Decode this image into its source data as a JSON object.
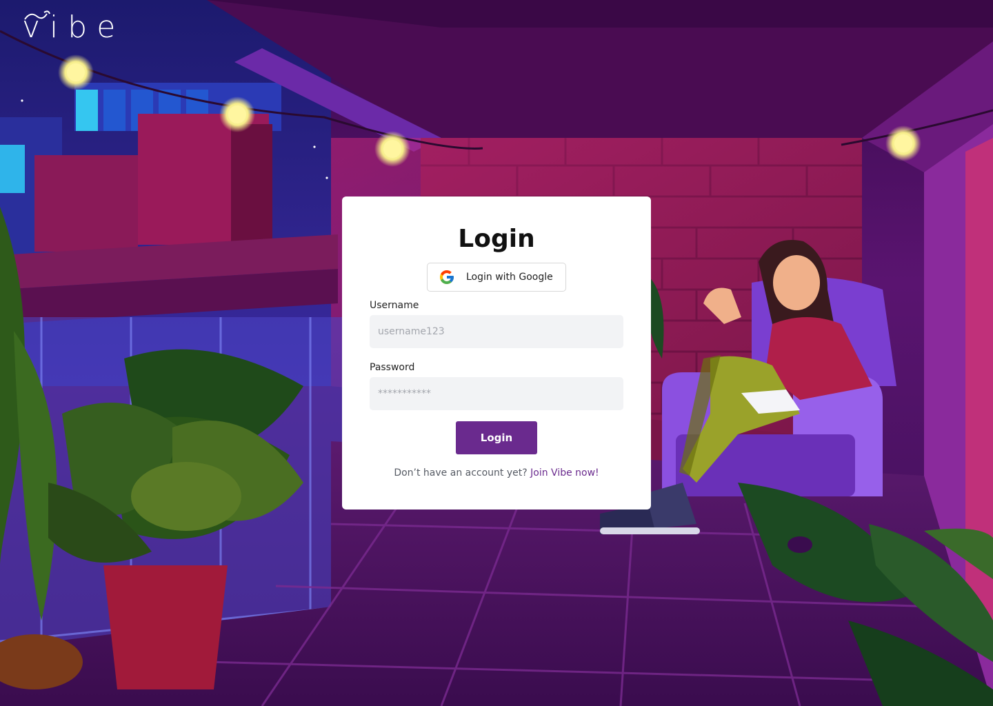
{
  "brand": {
    "logo_text": "vibe"
  },
  "login_card": {
    "title": "Login",
    "google_button_label": "Login with Google",
    "username": {
      "label": "Username",
      "value": "",
      "placeholder": "username123"
    },
    "password": {
      "label": "Password",
      "value": "",
      "placeholder": "***********"
    },
    "submit_label": "Login",
    "signup_prompt": "Don’t have an account yet?",
    "signup_link": "Join Vibe now!"
  },
  "colors": {
    "accent": "#6a2a8e",
    "card_bg": "#ffffff",
    "input_bg": "#f2f3f5",
    "background_dark": "#3a0a4f"
  },
  "icons": {
    "google": "google-g-icon",
    "logo_swirl": "wave-swirl-icon"
  }
}
